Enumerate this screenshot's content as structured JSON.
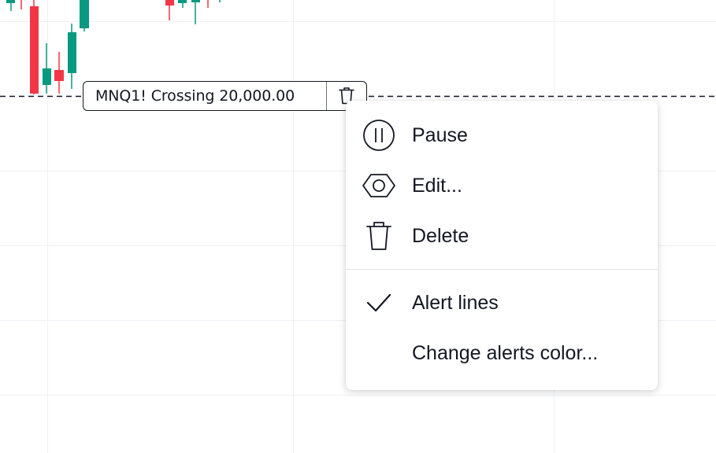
{
  "alert_label": {
    "text": "MNQ1! Crossing 20,000.00",
    "delete_icon": "trash-icon"
  },
  "context_menu": {
    "items": [
      {
        "label": "Pause",
        "icon": "pause-circle-icon"
      },
      {
        "label": "Edit...",
        "icon": "hexagon-edit-icon"
      },
      {
        "label": "Delete",
        "icon": "trash-icon"
      }
    ],
    "toggle_items": [
      {
        "label": "Alert lines",
        "icon": "checkmark-icon",
        "checked": true
      },
      {
        "label": "Change alerts color...",
        "icon": ""
      }
    ]
  },
  "colors": {
    "up_candle": "#089981",
    "down_candle": "#f23645",
    "text": "#131722",
    "grid": "#f0f3fa"
  }
}
